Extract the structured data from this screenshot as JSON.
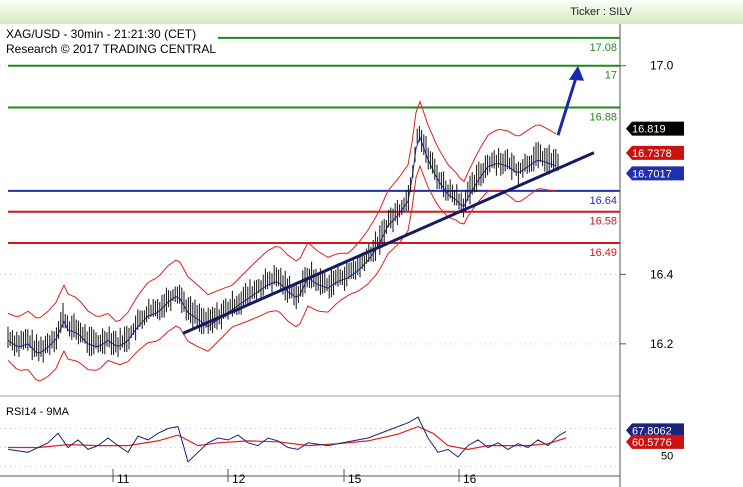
{
  "header": {
    "ticker": "Ticker : SILV"
  },
  "chart_data": {
    "type": "candlestick",
    "title": "XAG/USD - 30min - 21:21:30 (CET)",
    "subtitle": "Research © 2017 TRADING CENTRAL",
    "y_axis": {
      "ticks": [
        "17.0",
        "16.4",
        "16.2"
      ],
      "ylim": [
        16.05,
        17.12
      ]
    },
    "x_axis": {
      "ticks": [
        "11",
        "12",
        "15",
        "16"
      ]
    },
    "levels": [
      {
        "value": 17.08,
        "label": "17.08",
        "color": "#1f8a1f"
      },
      {
        "value": 17.0,
        "label": "17",
        "color": "#1f8a1f"
      },
      {
        "value": 16.88,
        "label": "16.88",
        "color": "#1f8a1f"
      },
      {
        "value": 16.64,
        "label": "16.64",
        "color": "#1f2fb0"
      },
      {
        "value": 16.58,
        "label": "16.58",
        "color": "#d01818"
      },
      {
        "value": 16.49,
        "label": "16.49",
        "color": "#d01818"
      }
    ],
    "price_tags": [
      {
        "value": 16.819,
        "label": "16.819",
        "bg": "#000000"
      },
      {
        "value": 16.7378,
        "label": "16.7378",
        "bg": "#cc1111"
      },
      {
        "value": 16.7017,
        "label": "16.7017",
        "bg": "#1f2fb0"
      }
    ],
    "price_path": [
      [
        0,
        16.22
      ],
      [
        10,
        16.2
      ],
      [
        20,
        16.21
      ],
      [
        30,
        16.18
      ],
      [
        40,
        16.2
      ],
      [
        50,
        16.23
      ],
      [
        55,
        16.28
      ],
      [
        60,
        16.25
      ],
      [
        70,
        16.24
      ],
      [
        80,
        16.21
      ],
      [
        90,
        16.2
      ],
      [
        100,
        16.22
      ],
      [
        110,
        16.2
      ],
      [
        120,
        16.22
      ],
      [
        130,
        16.26
      ],
      [
        140,
        16.29
      ],
      [
        150,
        16.3
      ],
      [
        160,
        16.33
      ],
      [
        170,
        16.35
      ],
      [
        180,
        16.3
      ],
      [
        190,
        16.28
      ],
      [
        200,
        16.26
      ],
      [
        210,
        16.28
      ],
      [
        220,
        16.3
      ],
      [
        230,
        16.32
      ],
      [
        240,
        16.34
      ],
      [
        250,
        16.36
      ],
      [
        260,
        16.38
      ],
      [
        270,
        16.39
      ],
      [
        280,
        16.36
      ],
      [
        290,
        16.34
      ],
      [
        300,
        16.4
      ],
      [
        310,
        16.38
      ],
      [
        320,
        16.37
      ],
      [
        330,
        16.39
      ],
      [
        340,
        16.4
      ],
      [
        350,
        16.42
      ],
      [
        360,
        16.45
      ],
      [
        370,
        16.49
      ],
      [
        380,
        16.55
      ],
      [
        390,
        16.58
      ],
      [
        400,
        16.62
      ],
      [
        405,
        16.7
      ],
      [
        410,
        16.82
      ],
      [
        415,
        16.78
      ],
      [
        420,
        16.74
      ],
      [
        430,
        16.68
      ],
      [
        440,
        16.64
      ],
      [
        450,
        16.62
      ],
      [
        455,
        16.6
      ],
      [
        460,
        16.63
      ],
      [
        470,
        16.68
      ],
      [
        480,
        16.72
      ],
      [
        490,
        16.73
      ],
      [
        500,
        16.72
      ],
      [
        510,
        16.7
      ],
      [
        520,
        16.72
      ],
      [
        530,
        16.74
      ],
      [
        540,
        16.73
      ],
      [
        550,
        16.72
      ],
      [
        555,
        16.78
      ],
      [
        558,
        16.82
      ]
    ],
    "trendline": {
      "from": [
        183,
        16.23
      ],
      "to": [
        594,
        16.75
      ]
    },
    "arrow": {
      "from": [
        558,
        16.8
      ],
      "to": [
        578,
        17.0
      ]
    },
    "rsi": {
      "label": "RSI14 - 9MA",
      "tick": "50",
      "tags": [
        {
          "label": "67.8062",
          "bg": "#1a237e"
        },
        {
          "label": "60.5776",
          "bg": "#cc1111"
        }
      ],
      "rsi_path": [
        [
          0,
          48
        ],
        [
          20,
          45
        ],
        [
          40,
          55
        ],
        [
          50,
          65
        ],
        [
          60,
          50
        ],
        [
          70,
          58
        ],
        [
          80,
          48
        ],
        [
          90,
          52
        ],
        [
          100,
          60
        ],
        [
          110,
          52
        ],
        [
          120,
          45
        ],
        [
          130,
          62
        ],
        [
          140,
          58
        ],
        [
          150,
          65
        ],
        [
          160,
          70
        ],
        [
          170,
          72
        ],
        [
          180,
          35
        ],
        [
          190,
          45
        ],
        [
          200,
          55
        ],
        [
          210,
          60
        ],
        [
          220,
          58
        ],
        [
          230,
          63
        ],
        [
          240,
          55
        ],
        [
          250,
          52
        ],
        [
          260,
          60
        ],
        [
          270,
          57
        ],
        [
          280,
          50
        ],
        [
          290,
          48
        ],
        [
          300,
          55
        ],
        [
          320,
          52
        ],
        [
          340,
          56
        ],
        [
          360,
          60
        ],
        [
          380,
          68
        ],
        [
          400,
          76
        ],
        [
          410,
          82
        ],
        [
          420,
          60
        ],
        [
          430,
          45
        ],
        [
          440,
          48
        ],
        [
          450,
          40
        ],
        [
          460,
          52
        ],
        [
          470,
          58
        ],
        [
          480,
          50
        ],
        [
          490,
          55
        ],
        [
          500,
          48
        ],
        [
          510,
          54
        ],
        [
          520,
          50
        ],
        [
          530,
          58
        ],
        [
          540,
          52
        ],
        [
          550,
          62
        ],
        [
          558,
          67
        ]
      ],
      "ma_path": [
        [
          0,
          50
        ],
        [
          30,
          50
        ],
        [
          60,
          53
        ],
        [
          90,
          52
        ],
        [
          120,
          52
        ],
        [
          150,
          57
        ],
        [
          170,
          63
        ],
        [
          190,
          52
        ],
        [
          210,
          55
        ],
        [
          240,
          57
        ],
        [
          270,
          56
        ],
        [
          300,
          52
        ],
        [
          330,
          54
        ],
        [
          360,
          57
        ],
        [
          390,
          64
        ],
        [
          410,
          72
        ],
        [
          425,
          65
        ],
        [
          440,
          52
        ],
        [
          460,
          48
        ],
        [
          480,
          52
        ],
        [
          500,
          52
        ],
        [
          520,
          52
        ],
        [
          540,
          54
        ],
        [
          558,
          60
        ]
      ]
    }
  }
}
